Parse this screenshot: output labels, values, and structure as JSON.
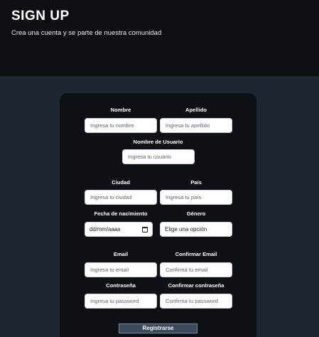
{
  "header": {
    "title": "SIGN UP",
    "subtitle": "Crea una cuenta y se parte de nuestra comunidad"
  },
  "form": {
    "nombre": {
      "label": "Nombre",
      "placeholder": "Ingresa tu nombre"
    },
    "apellido": {
      "label": "Apellido",
      "placeholder": "Ingresa tu apellido"
    },
    "usuario": {
      "label": "Nombre de Usuario",
      "placeholder": "Ingresa tu usuario"
    },
    "ciudad": {
      "label": "Ciudad",
      "placeholder": "Ingresa tu ciudad"
    },
    "pais": {
      "label": "País",
      "placeholder": "Ingresa tu país"
    },
    "fecha": {
      "label": "Fecha de nacimiento",
      "value": "dd/mm/aaaa"
    },
    "genero": {
      "label": "Género",
      "value": "Elige una opción"
    },
    "email": {
      "label": "Email",
      "placeholder": "Ingresa tu email"
    },
    "confirmar_email": {
      "label": "Confirmar Email",
      "placeholder": "Confirmá tu email"
    },
    "password": {
      "label": "Contraseña",
      "placeholder": "Ingresa tu password"
    },
    "confirmar_password": {
      "label": "Confirmar contraseña",
      "placeholder": "Confirma tu password"
    },
    "submit_label": "Registrarse"
  },
  "icons": {
    "calendar": "calendar-icon"
  }
}
